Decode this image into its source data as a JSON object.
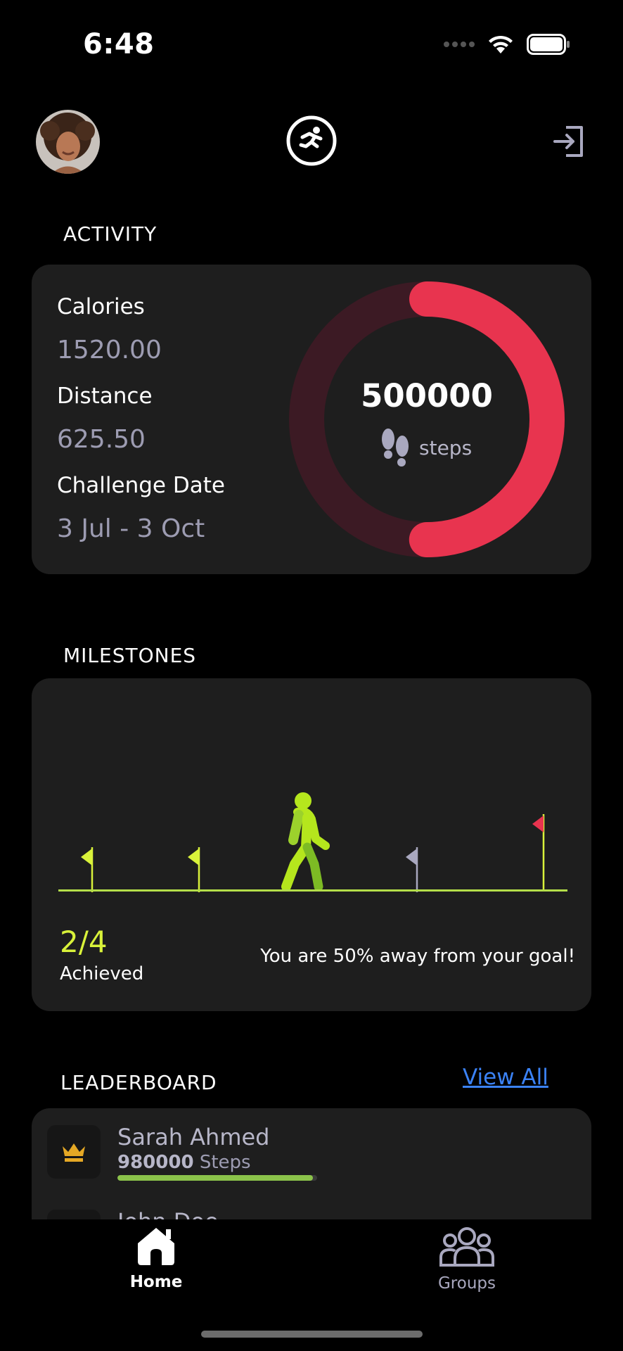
{
  "status_bar": {
    "time": "6:48"
  },
  "header": {
    "avatar_icon": "user-avatar",
    "logo_icon": "running-person-icon",
    "action_icon": "login-icon"
  },
  "activity": {
    "title": "ACTIVITY",
    "calories_label": "Calories",
    "calories_value": "1520.00",
    "distance_label": "Distance",
    "distance_value": "625.50",
    "date_label": "Challenge Date",
    "date_value": "3 Jul - 3 Oct",
    "steps_value": "500000",
    "steps_unit": "steps",
    "progress": 0.5,
    "ring_color": "#e8344f",
    "ring_track_color": "#3c1a24"
  },
  "milestones": {
    "title": "MILESTONES",
    "achieved_count": "2/4",
    "achieved_label": "Achieved",
    "message": "You are 50% away from your goal!",
    "accent_color": "#d9f23a"
  },
  "leaderboard": {
    "title": "LEADERBOARD",
    "view_all": "View All",
    "entries": [
      {
        "name": "Sarah Ahmed",
        "steps": "980000",
        "steps_label": "Steps",
        "progress": 0.98,
        "badge_icon": "crown-icon"
      },
      {
        "name": "John Doe",
        "steps": "",
        "steps_label": "",
        "progress": 0
      }
    ]
  },
  "tabs": [
    {
      "label": "Home",
      "icon": "home-icon",
      "active": true
    },
    {
      "label": "Groups",
      "icon": "groups-icon",
      "active": false
    }
  ]
}
